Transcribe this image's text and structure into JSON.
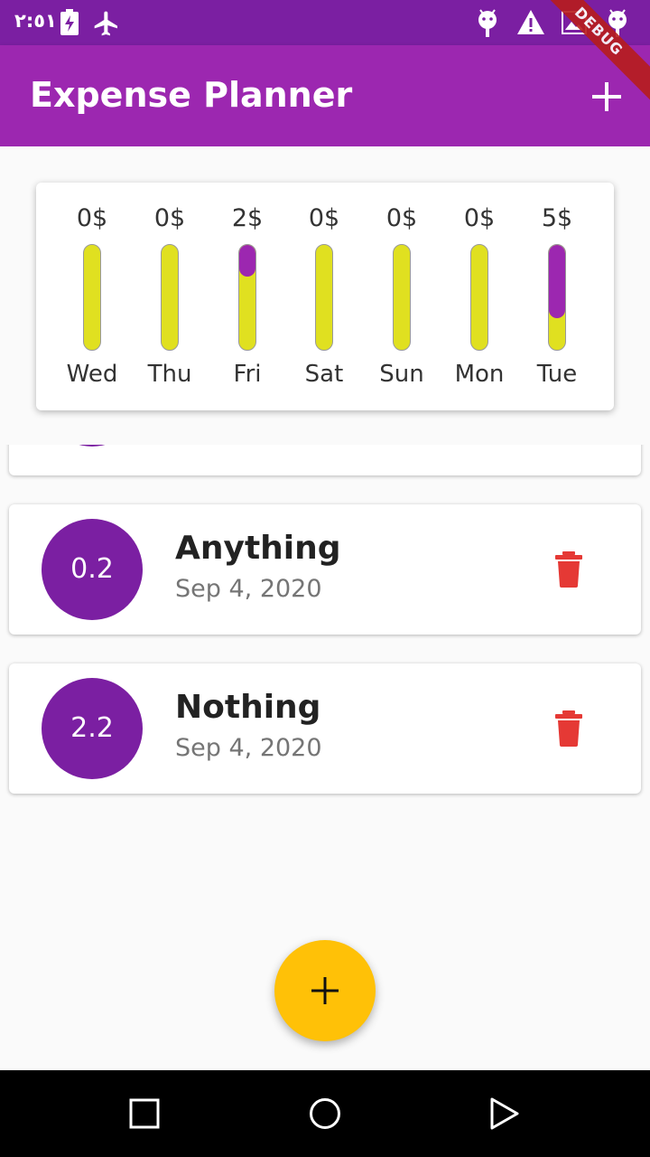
{
  "status_bar": {
    "time": "٢:٥١",
    "icons": [
      "battery-charging-icon",
      "airplane-icon",
      "android-debug-icon",
      "warning-icon",
      "image-icon",
      "android-icon"
    ]
  },
  "app_bar": {
    "title": "Expense Planner",
    "add_icon": "plus-icon",
    "debug_label": "DEBUG"
  },
  "colors": {
    "primary": "#9c27b0",
    "primary_dark": "#7b1fa2",
    "accent": "#ffc107",
    "bar_empty": "#e0e020",
    "delete": "#e53935"
  },
  "chart": {
    "days": [
      {
        "label": "Wed",
        "amount": "0$",
        "fraction": 0
      },
      {
        "label": "Thu",
        "amount": "0$",
        "fraction": 0
      },
      {
        "label": "Fri",
        "amount": "2$",
        "fraction": 0.3
      },
      {
        "label": "Sat",
        "amount": "0$",
        "fraction": 0
      },
      {
        "label": "Sun",
        "amount": "0$",
        "fraction": 0
      },
      {
        "label": "Mon",
        "amount": "0$",
        "fraction": 0
      },
      {
        "label": "Tue",
        "amount": "5$",
        "fraction": 0.7
      }
    ]
  },
  "transactions": [
    {
      "amount": "0.2",
      "title": "Anything",
      "date": "Sep 4, 2020",
      "delete_icon": "trash-icon"
    },
    {
      "amount": "2.2",
      "title": "Nothing",
      "date": "Sep 4, 2020",
      "delete_icon": "trash-icon"
    }
  ],
  "fab": {
    "icon": "plus-icon"
  },
  "nav_bar": {
    "icons": [
      "recents-square-icon",
      "home-circle-icon",
      "back-triangle-icon"
    ]
  }
}
